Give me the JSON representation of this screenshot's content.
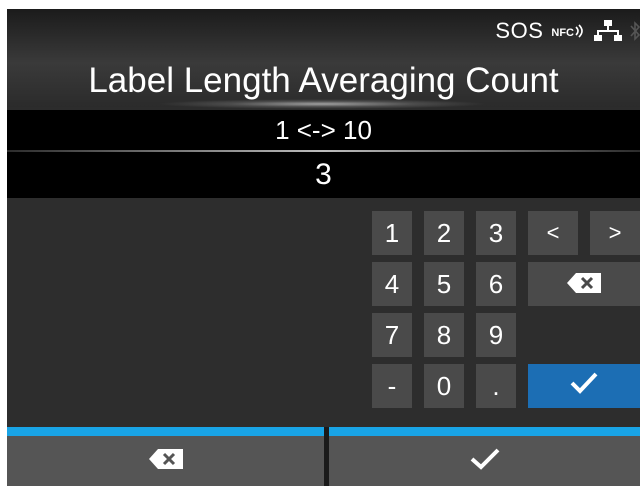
{
  "header": {
    "title": "Label Length Averaging Count",
    "status": {
      "sos_label": "SOS",
      "nfc_label": "NFC",
      "icons": [
        "nfc-icon",
        "network-icon",
        "bluetooth-icon"
      ]
    }
  },
  "input": {
    "range": "1 <-> 10",
    "value": "3"
  },
  "keypad": {
    "keys": [
      "1",
      "2",
      "3",
      "<",
      ">",
      "4",
      "5",
      "6",
      "7",
      "8",
      "9",
      "-",
      "0",
      "."
    ],
    "backspace_icon": "backspace-icon",
    "enter_icon": "check-icon"
  },
  "footer": {
    "left_icon": "backspace-icon",
    "right_icon": "check-icon"
  },
  "colors": {
    "accent": "#19a4e6",
    "enter_key": "#1c6eb4",
    "key_bg": "#4a4a4a",
    "screen_bg": "#2c2c2c"
  }
}
